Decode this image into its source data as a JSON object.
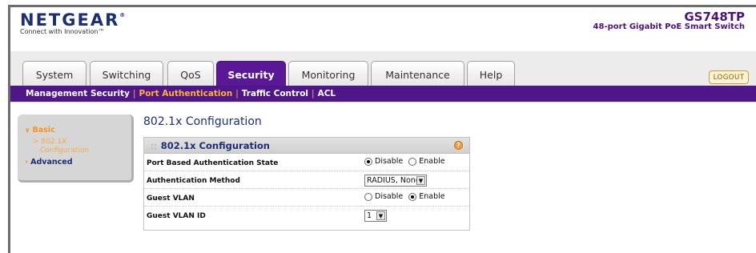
{
  "brand": {
    "logo": "NETGEAR",
    "tagline": "Connect with Innovation™"
  },
  "device": {
    "model": "GS748TP",
    "description": "48-port Gigabit PoE Smart Switch"
  },
  "tabs": [
    {
      "label": "System"
    },
    {
      "label": "Switching"
    },
    {
      "label": "QoS"
    },
    {
      "label": "Security"
    },
    {
      "label": "Monitoring"
    },
    {
      "label": "Maintenance"
    },
    {
      "label": "Help"
    }
  ],
  "logout_label": "LOGOUT",
  "subnav": [
    {
      "label": "Management Security"
    },
    {
      "label": "Port Authentication"
    },
    {
      "label": "Traffic Control"
    },
    {
      "label": "ACL"
    }
  ],
  "sidebar": {
    "basic": "Basic",
    "basic_sub_line1": "802.1X",
    "basic_sub_line2": "Configuration",
    "advanced": "Advanced"
  },
  "page": {
    "title": "802.1x Configuration"
  },
  "panel": {
    "title": "802.1x Configuration",
    "help_symbol": "?",
    "rows": {
      "port_auth": {
        "label": "Port Based Authentication State",
        "options": [
          "Disable",
          "Enable"
        ],
        "selected": "Disable"
      },
      "auth_method": {
        "label": "Authentication Method",
        "value": "RADIUS, None"
      },
      "guest_vlan": {
        "label": "Guest VLAN",
        "options": [
          "Disable",
          "Enable"
        ],
        "selected": "Enable"
      },
      "guest_vlan_id": {
        "label": "Guest VLAN ID",
        "value": "1"
      }
    }
  },
  "colors": {
    "brand_purple": "#5a1896",
    "subnav_purple": "#4e1689",
    "accent_orange": "#f7931e",
    "navy": "#1c2f73"
  },
  "icons": {
    "help": "help-icon",
    "dropdown": "chevron-down-icon"
  }
}
